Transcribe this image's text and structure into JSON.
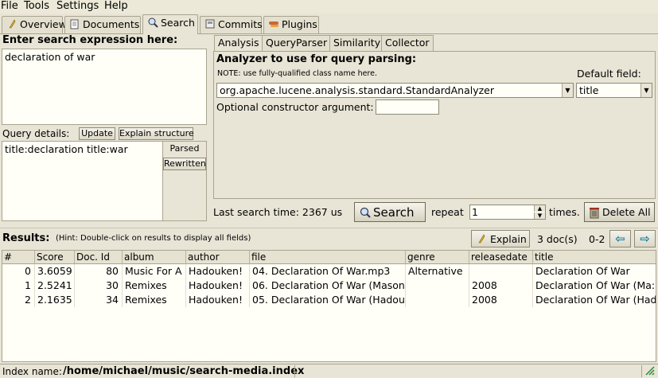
{
  "menu": [
    "File",
    "Tools",
    "Settings",
    "Help"
  ],
  "top_tabs": [
    "Overview",
    "Documents",
    "Search",
    "Commits",
    "Plugins"
  ],
  "search": {
    "heading": "Enter search expression here:",
    "expression": "declaration of war",
    "query_details_label": "Query details:",
    "update_label": "Update",
    "explain_structure_label": "Explain structure",
    "parsed_query": "title:declaration title:war",
    "parsed_label": "Parsed",
    "rewritten_label": "Rewritten"
  },
  "sub_tabs": [
    "Analysis",
    "QueryParser",
    "Similarity",
    "Collector"
  ],
  "analysis": {
    "heading": "Analyzer to use for query parsing:",
    "note": "NOTE: use fully-qualified class name here.",
    "analyzer": "org.apache.lucene.analysis.standard.StandardAnalyzer",
    "default_field_label": "Default field:",
    "default_field": "title",
    "ctor_label": "Optional constructor argument:",
    "ctor_value": ""
  },
  "controls": {
    "last_search": "Last search time: 2367 us",
    "search_button": "Search",
    "repeat_label": "repeat",
    "repeat_value": "1",
    "times_label": "times.",
    "delete_all": "Delete All"
  },
  "results": {
    "label": "Results:",
    "hint": "(Hint: Double-click on results to display all fields)",
    "explain": "Explain",
    "doc_count": "3 doc(s)",
    "range": "0-2",
    "columns": [
      "#",
      "Score",
      "Doc. Id",
      "album",
      "author",
      "file",
      "genre",
      "releasedate",
      "title"
    ],
    "rows": [
      [
        "0",
        "3.6059",
        "80",
        "Music For A",
        "Hadouken!",
        "04. Declaration Of War.mp3",
        "Alternative",
        "",
        "Declaration Of War"
      ],
      [
        "1",
        "2.5241",
        "30",
        "Remixes",
        "Hadouken!",
        "06. Declaration Of War (Mason",
        "",
        "2008",
        "Declaration Of War (Ma:"
      ],
      [
        "2",
        "2.1635",
        "34",
        "Remixes",
        "Hadouken!",
        "05. Declaration Of War (Hadou",
        "",
        "2008",
        "Declaration Of War (Had"
      ]
    ]
  },
  "status": {
    "index_label": "Index name:",
    "index_path": "/home/michael/music/search-media.index"
  },
  "colors": {
    "accent_arrow": "#1a7fa8",
    "background": "#e9e5d6"
  }
}
